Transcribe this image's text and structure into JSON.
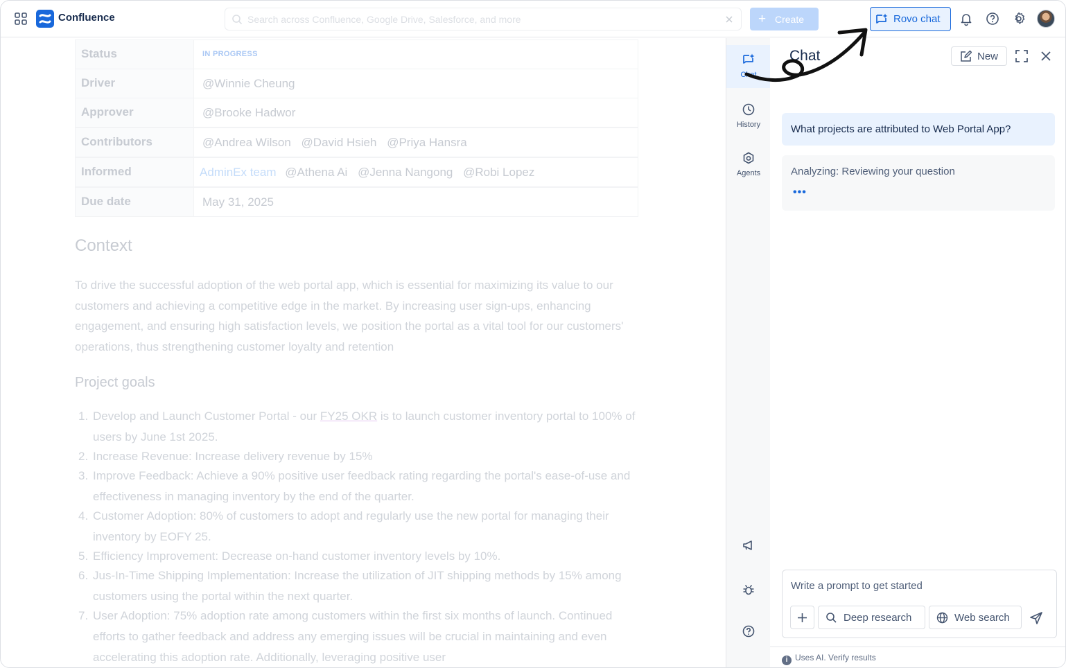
{
  "topbar": {
    "app_name": "Confluence",
    "search_placeholder": "Search across Confluence, Google Drive, Salesforce, and more",
    "create_label": "Create",
    "rovo_label": "Rovo chat"
  },
  "properties": [
    {
      "key": "Status",
      "value": "IN PROGRESS"
    },
    {
      "key": "Driver",
      "value": "@Winnie Cheung"
    },
    {
      "key": "Approver",
      "value": "@Brooke Hadwor"
    },
    {
      "key": "Contributors",
      "values": [
        "@Andrea Wilson",
        "@David Hsieh",
        "@Priya Hansra"
      ]
    },
    {
      "key": "Informed",
      "link": "AdminEx team",
      "values": [
        "@Athena Ai",
        "@Jenna Nangong",
        "@Robi Lopez"
      ]
    },
    {
      "key": "Due date",
      "value": "May 31, 2025"
    }
  ],
  "doc": {
    "context_heading": "Context",
    "context_text": "To drive the successful adoption of the web portal app, which is essential for maximizing its value to our customers and achieving a competitive edge in the market. By increasing user sign-ups, enhancing engagement, and ensuring high satisfaction levels, we position the portal as a vital tool for our customers' operations, thus strengthening customer loyalty and retention",
    "goals_heading": "Project goals",
    "goals": [
      {
        "num": "1.",
        "pre": "Develop and Launch Customer Portal  - our ",
        "link": "FY25 OKR",
        "post": " is to launch customer inventory portal to 100% of users by June 1st 2025."
      },
      {
        "num": "2.",
        "text": "Increase Revenue: Increase delivery revenue by 15%"
      },
      {
        "num": "3.",
        "text": "Improve Feedback: Achieve a 90% positive user feedback rating regarding the portal's ease-of-use and effectiveness in managing inventory by the end of the quarter."
      },
      {
        "num": "4.",
        "text": "Customer Adoption: 80% of customers to adopt and regularly use the new portal for managing their inventory by EOFY 25."
      },
      {
        "num": "5.",
        "text": "Efficiency Improvement: Decrease on-hand customer inventory levels by 10%."
      },
      {
        "num": "6.",
        "text": "Jus-In-Time Shipping Implementation: Increase the utilization of JIT shipping methods by 15% among customers using the portal within the next quarter."
      },
      {
        "num": "7.",
        "text": "User Adoption:  75% adoption rate among customers within the first six months of launch. Continued efforts to gather feedback and address any emerging issues will be crucial in maintaining and even accelerating this adoption rate. Additionally, leveraging positive user"
      }
    ]
  },
  "sidenav": {
    "items": [
      {
        "label": "Chat",
        "icon": "chat-sparkle-icon"
      },
      {
        "label": "History",
        "icon": "clock-icon"
      },
      {
        "label": "Agents",
        "icon": "agents-icon"
      }
    ]
  },
  "chat": {
    "title": "Chat",
    "new_label": "New",
    "user_message": "What projects are attributed to Web Portal App?",
    "ai_status": "Analyzing: Reviewing your question",
    "ai_dots": "•••",
    "composer_placeholder": "Write a prompt to get started",
    "deep_research_label": "Deep research",
    "web_search_label": "Web search",
    "disclaimer": "Uses AI. Verify results"
  },
  "colors": {
    "accent": "#1868db",
    "accent_light": "#e9f2fe"
  }
}
